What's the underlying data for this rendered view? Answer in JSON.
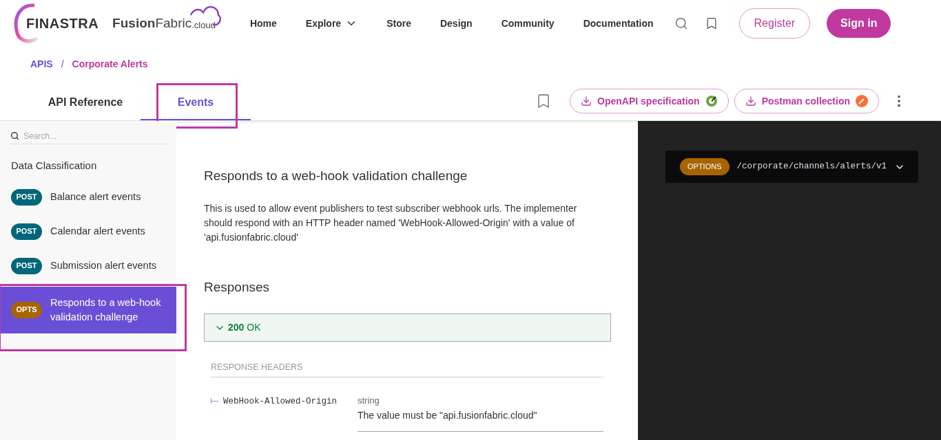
{
  "header": {
    "brand": "FINASTRA",
    "product": "**Fusion**Fabric",
    "product_suffix": ".cloud",
    "nav": [
      {
        "label": "Home",
        "dropdown": false
      },
      {
        "label": "Explore",
        "dropdown": true
      },
      {
        "label": "Store",
        "dropdown": false
      },
      {
        "label": "Design",
        "dropdown": false
      },
      {
        "label": "Community",
        "dropdown": false
      },
      {
        "label": "Documentation",
        "dropdown": false
      }
    ],
    "register": "Register",
    "sign_in": "Sign in"
  },
  "breadcrumb": {
    "items": [
      "APIS",
      "Corporate Alerts"
    ],
    "separator": "/"
  },
  "tabs": [
    {
      "label": "API Reference",
      "selected": false,
      "highlighted": false
    },
    {
      "label": "Events",
      "selected": true,
      "highlighted": true
    }
  ],
  "downloads": [
    {
      "label": "OpenAPI specification",
      "kind": "openapi"
    },
    {
      "label": "Postman collection",
      "kind": "postman"
    }
  ],
  "sidebar": {
    "search": {
      "placeholder": "Search..."
    },
    "section": "Data Classification",
    "items": [
      {
        "method": "POST",
        "color": "#00677a",
        "label": "Balance alert events",
        "selected": false,
        "highlighted": false
      },
      {
        "method": "POST",
        "color": "#00677a",
        "label": "Calendar alert events",
        "selected": false,
        "highlighted": false
      },
      {
        "method": "POST",
        "color": "#00677a",
        "label": "Submission alert events",
        "selected": false,
        "highlighted": false
      },
      {
        "method": "OPTS",
        "color": "#a86400",
        "label": "Responds to a web-hook validation challenge",
        "selected": true,
        "highlighted": true
      }
    ]
  },
  "main": {
    "title": "Responds to a web-hook validation challenge",
    "description": "This is used to allow event publishers to test subscriber webhook urls. The implementer should respond with an HTTP header named 'WebHook-Allowed-Origin' with a value of 'api.fusionfabric.cloud'",
    "responses_title": "Responses",
    "response": {
      "code": "200",
      "status": "OK",
      "expanded": true
    },
    "headers_title": "RESPONSE HEADERS",
    "headers": [
      {
        "name": "WebHook-Allowed-Origin",
        "type": "string",
        "description": "The value must be \"api.fusionfabric.cloud\""
      }
    ]
  },
  "code_panel": {
    "method": "OPTIONS",
    "color": "#a86400",
    "path": "/corporate/channels/alerts/v1"
  }
}
